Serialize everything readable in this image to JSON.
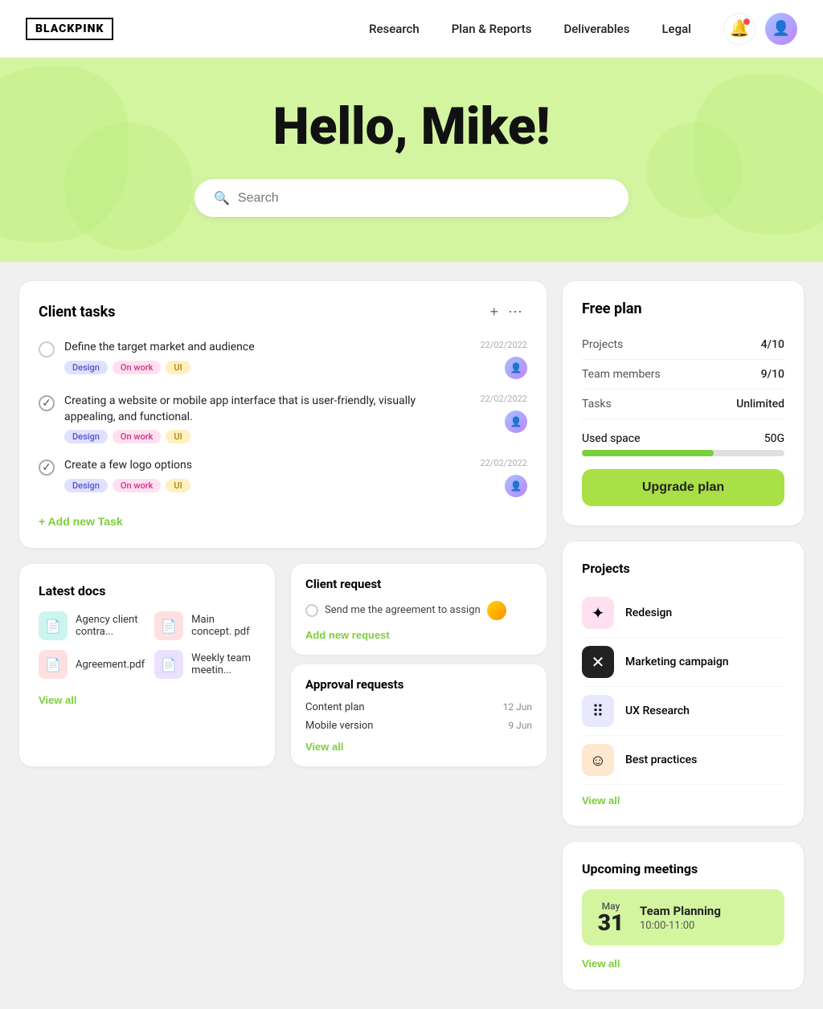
{
  "logo": "BLACKPINK",
  "nav": {
    "links": [
      "Research",
      "Plan & Reports",
      "Deliverables",
      "Legal"
    ]
  },
  "hero": {
    "greeting": "Hello, Mike!",
    "search_placeholder": "Search"
  },
  "client_tasks": {
    "title": "Client tasks",
    "tasks": [
      {
        "id": 1,
        "done": false,
        "text": "Define the target market and audience",
        "tags": [
          "Design",
          "On work",
          "UI"
        ],
        "date": "22/02/2022"
      },
      {
        "id": 2,
        "done": true,
        "text": "Creating a website or mobile app interface that is user-friendly, visually appealing, and functional.",
        "tags": [
          "Design",
          "On work",
          "UI"
        ],
        "date": "22/02/2022"
      },
      {
        "id": 3,
        "done": true,
        "text": "Create a few logo options",
        "tags": [
          "Design",
          "On work",
          "UI"
        ],
        "date": "22/02/2022"
      }
    ],
    "add_label": "+ Add new Task"
  },
  "free_plan": {
    "title": "Free plan",
    "rows": [
      {
        "label": "Projects",
        "value": "4/10"
      },
      {
        "label": "Team members",
        "value": "9/10"
      },
      {
        "label": "Tasks",
        "value": "Unlimited"
      }
    ],
    "used_space_label": "Used space",
    "used_space_value": "50G",
    "progress_percent": 65,
    "upgrade_label": "Upgrade plan"
  },
  "latest_docs": {
    "title": "Latest docs",
    "docs": [
      {
        "name": "Agency client contra...",
        "color": "teal",
        "icon": "📄"
      },
      {
        "name": "Main concept. pdf",
        "color": "red",
        "icon": "📄"
      },
      {
        "name": "Agreement.pdf",
        "color": "red",
        "icon": "📄"
      },
      {
        "name": "Weekly team meetin...",
        "color": "purple",
        "icon": "📄"
      }
    ],
    "view_all": "View all"
  },
  "projects": {
    "title": "Projects",
    "items": [
      {
        "name": "Redesign",
        "icon": "✦",
        "color": "pink"
      },
      {
        "name": "Marketing campaign",
        "icon": "✕",
        "color": "dark"
      },
      {
        "name": "UX Research",
        "icon": "⠿",
        "color": "light"
      },
      {
        "name": "Best practices",
        "icon": "☺",
        "color": "orange"
      }
    ],
    "view_all": "View all"
  },
  "upcoming_meetings": {
    "title": "Upcoming meetings",
    "meeting": {
      "month": "May",
      "day": "31",
      "name": "Team Planning",
      "time": "10:00-11:00"
    },
    "view_all": "View all"
  },
  "client_request": {
    "title": "Client request",
    "task": "Send me the agreement to assign",
    "add_label": "Add new request"
  },
  "approval_requests": {
    "title": "Approval requests",
    "items": [
      {
        "name": "Content plan",
        "date": "12 Jun"
      },
      {
        "name": "Mobile version",
        "date": "9 Jun"
      }
    ],
    "view_all": "View all"
  }
}
